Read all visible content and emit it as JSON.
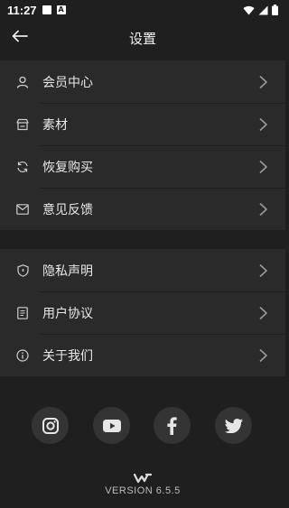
{
  "status_bar": {
    "time": "11:27",
    "a_badge": "A"
  },
  "header": {
    "title": "设置"
  },
  "group1": [
    {
      "label": "会员中心",
      "icon": "person-icon"
    },
    {
      "label": "素材",
      "icon": "store-icon"
    },
    {
      "label": "恢复购买",
      "icon": "refresh-icon"
    },
    {
      "label": "意见反馈",
      "icon": "mail-icon"
    }
  ],
  "group2": [
    {
      "label": "隐私声明",
      "icon": "shield-icon"
    },
    {
      "label": "用户协议",
      "icon": "document-icon"
    },
    {
      "label": "关于我们",
      "icon": "info-icon"
    }
  ],
  "socials": [
    "instagram-icon",
    "youtube-icon",
    "facebook-icon",
    "twitter-icon"
  ],
  "footer": {
    "version": "VERSION 6.5.5"
  },
  "colors": {
    "background": "#1f1f1f",
    "row_bg": "#2a2a2a",
    "social_bg": "#343434"
  }
}
